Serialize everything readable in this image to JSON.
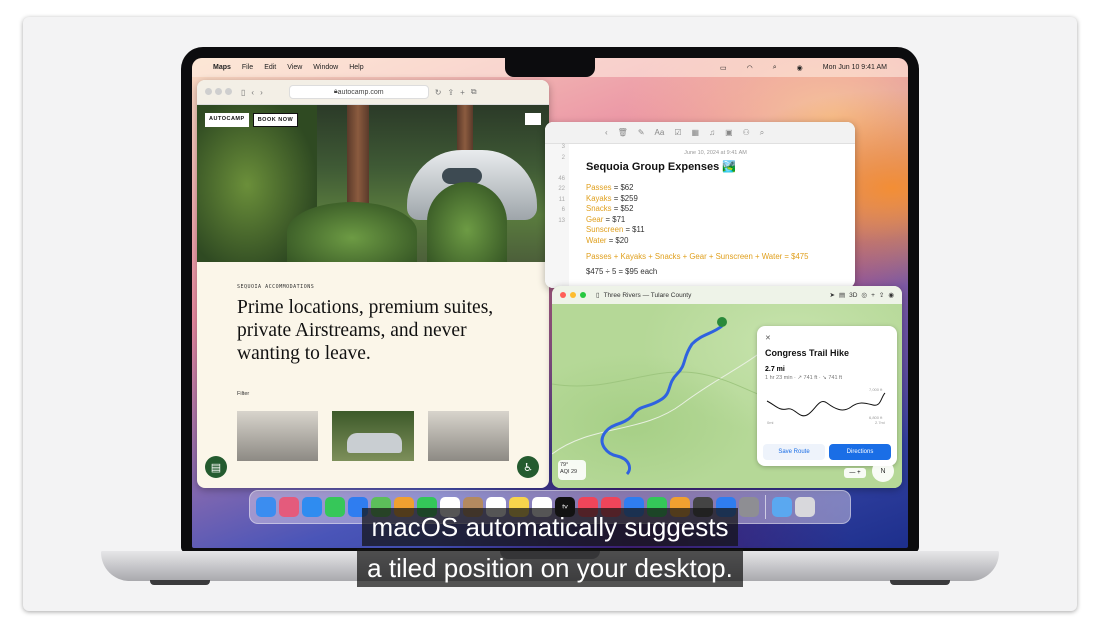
{
  "menubar": {
    "app": "Maps",
    "items": [
      "File",
      "Edit",
      "View",
      "Window",
      "Help"
    ],
    "datetime": "Mon Jun 10  9:41 AM"
  },
  "safari": {
    "url": "autocamp.com",
    "brand": "AUTOCAMP",
    "book_now": "BOOK NOW",
    "eyebrow": "SEQUOIA ACCOMMODATIONS",
    "headline": "Prime locations, premium suites, private Airstreams, and never wanting to leave.",
    "filter": "Filter"
  },
  "notes": {
    "date": "June 10, 2024 at 9:41 AM",
    "title": "Sequoia Group Expenses 🏞️",
    "gutter": [
      "3",
      "2",
      "",
      "46",
      "22",
      "11",
      "6",
      "13",
      "",
      "",
      "",
      "",
      ""
    ],
    "items": [
      {
        "name": "Passes",
        "value": "= $62"
      },
      {
        "name": "Kayaks",
        "value": "= $259"
      },
      {
        "name": "Snacks",
        "value": "= $52"
      },
      {
        "name": "Gear",
        "value": "= $71"
      },
      {
        "name": "Sunscreen",
        "value": "= $11"
      },
      {
        "name": "Water",
        "value": "= $20"
      }
    ],
    "sum_line": "Passes + Kayaks + Snacks + Gear + Sunscreen + Water = $475",
    "split_line": "$475 ÷ 5 = $95 each"
  },
  "maps": {
    "location": "Three Rivers — Tulare County",
    "controls": [
      "3D"
    ],
    "card": {
      "close": "✕",
      "title": "Congress Trail Hike",
      "distance": "2.7 mi",
      "subtitle": "1 hr 23 min · ↗ 741 ft · ↘ 741 ft",
      "chart_high": "7,000 ft",
      "chart_low": "6,800 ft",
      "chart_start": "0mi",
      "chart_end": "2.7mi",
      "save_route": "Save Route",
      "directions": "Directions"
    },
    "weather": {
      "temp": "79°",
      "aqi": "AQI 29"
    },
    "zoom": "— +",
    "compass": "N"
  },
  "dock": {
    "apps": [
      {
        "icon": "finder-icon",
        "color": "#3b8df0"
      },
      {
        "icon": "launchpad-icon",
        "color": "#e45b7c"
      },
      {
        "icon": "safari-icon",
        "color": "#2f8cf0"
      },
      {
        "icon": "messages-icon",
        "color": "#36c759"
      },
      {
        "icon": "mail-icon",
        "color": "#2f7df0"
      },
      {
        "icon": "maps-icon",
        "color": "#5cbf5a"
      },
      {
        "icon": "photos-icon",
        "color": "#f0a030"
      },
      {
        "icon": "facetime-icon",
        "color": "#34c759"
      },
      {
        "icon": "calendar-icon",
        "color": "#ffffff"
      },
      {
        "icon": "contacts-icon",
        "color": "#b48a60"
      },
      {
        "icon": "reminders-icon",
        "color": "#ffffff"
      },
      {
        "icon": "notes-icon",
        "color": "#f7d44c"
      },
      {
        "icon": "freeform-icon",
        "color": "#ffffff"
      },
      {
        "icon": "tv-icon",
        "color": "#111111"
      },
      {
        "icon": "music-icon",
        "color": "#f0455a"
      },
      {
        "icon": "news-icon",
        "color": "#f0455a"
      },
      {
        "icon": "keynote-icon",
        "color": "#2f7df0"
      },
      {
        "icon": "numbers-icon",
        "color": "#34c759"
      },
      {
        "icon": "pages-icon",
        "color": "#f0a030"
      },
      {
        "icon": "iphone-mirroring-icon",
        "color": "#444444"
      },
      {
        "icon": "app-store-icon",
        "color": "#2f7df0"
      },
      {
        "icon": "system-settings-icon",
        "color": "#8e8e93"
      }
    ],
    "trailing": [
      {
        "icon": "downloads-folder-icon",
        "color": "#5aa8f0"
      },
      {
        "icon": "trash-icon",
        "color": "#d8d8dc"
      }
    ],
    "tv_label": "tv"
  },
  "subtitles": {
    "line1": "macOS automatically suggests",
    "line2": "a tiled position on your desktop."
  }
}
